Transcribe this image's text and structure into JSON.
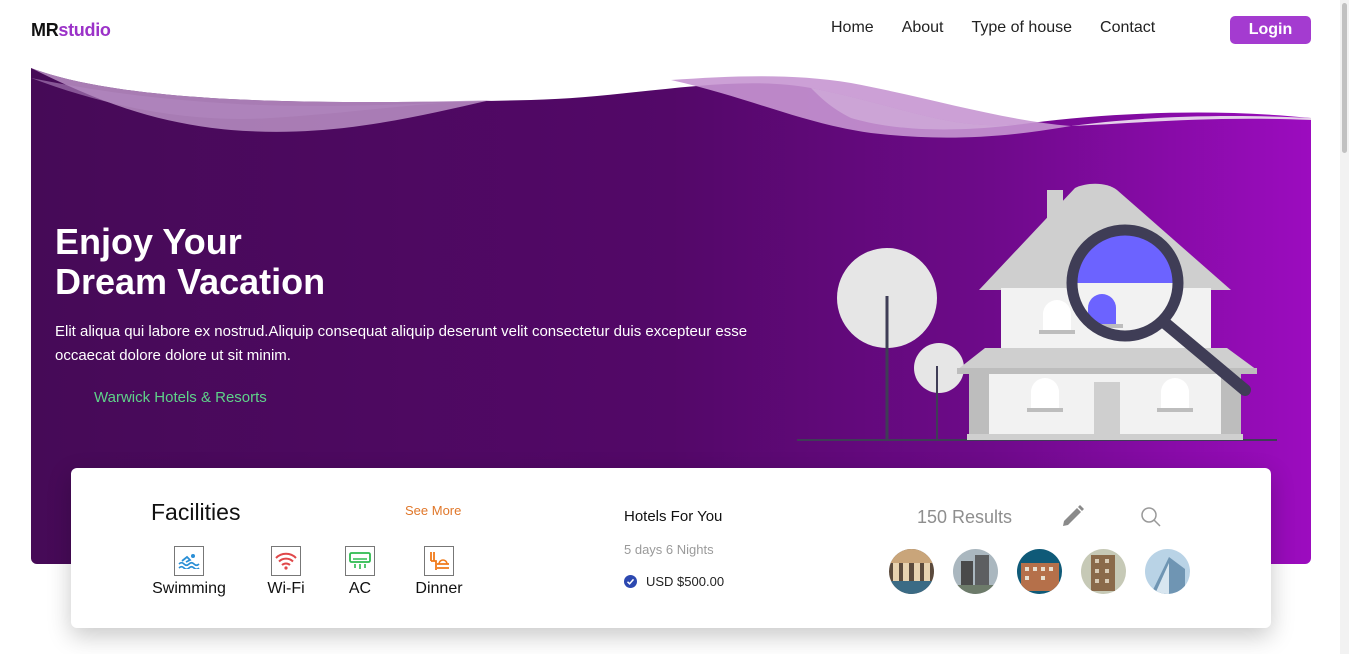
{
  "brand": {
    "part1": "MR",
    "part2": "studio"
  },
  "nav": {
    "items": [
      "Home",
      "About",
      "Type of house",
      "Contact"
    ],
    "login_label": "Login"
  },
  "hero": {
    "title_line1": "Enjoy Your",
    "title_line2": "Dream Vacation",
    "description": "Elit aliqua qui labore ex nostrud.Aliquip consequat aliquip deserunt velit consectetur duis excepteur esse occaecat dolore dolore ut sit minim.",
    "link": "Warwick Hotels & Resorts"
  },
  "facilities": {
    "title": "Facilities",
    "see_more": "See More",
    "items": [
      {
        "label": "Swimming",
        "icon": "swimming-icon",
        "color": "#2a8fd6"
      },
      {
        "label": "Wi-Fi",
        "icon": "wifi-icon",
        "color": "#e0484a"
      },
      {
        "label": "AC",
        "icon": "ac-icon",
        "color": "#2dbb4f"
      },
      {
        "label": "Dinner",
        "icon": "dinner-icon",
        "color": "#f07a1a"
      }
    ]
  },
  "hotels": {
    "title": "Hotels For You",
    "duration": "5 days 6 Nights",
    "price": "USD $500.00",
    "results": "150 Results"
  },
  "colors": {
    "brand_purple": "#9b32c8",
    "login_bg": "#a43bd0",
    "hero_dark": "#4a0b5e",
    "hero_light": "#9c0cbf",
    "link_green": "#5fd28a",
    "see_more_orange": "#e0772a",
    "check_blue": "#2c48b0",
    "magnifier_fill": "#6c63ff"
  }
}
